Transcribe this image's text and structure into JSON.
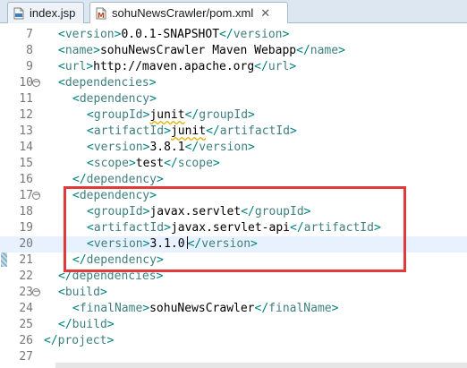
{
  "tabs": [
    {
      "label": "index.jsp",
      "active": false
    },
    {
      "label": "sohuNewsCrawler/pom.xml",
      "active": true
    }
  ],
  "lines": [
    {
      "num": "7",
      "indent": 1,
      "fold": false,
      "segs": [
        [
          "br",
          "<"
        ],
        [
          "tag",
          "version"
        ],
        [
          "br",
          ">"
        ],
        [
          "txt",
          "0.0.1-SNAPSHOT"
        ],
        [
          "br",
          "</"
        ],
        [
          "tag",
          "version"
        ],
        [
          "br",
          ">"
        ]
      ]
    },
    {
      "num": "8",
      "indent": 1,
      "fold": false,
      "segs": [
        [
          "br",
          "<"
        ],
        [
          "tag",
          "name"
        ],
        [
          "br",
          ">"
        ],
        [
          "txt",
          "sohuNewsCrawler Maven Webapp"
        ],
        [
          "br",
          "</"
        ],
        [
          "tag",
          "name"
        ],
        [
          "br",
          ">"
        ]
      ]
    },
    {
      "num": "9",
      "indent": 1,
      "fold": false,
      "segs": [
        [
          "br",
          "<"
        ],
        [
          "tag",
          "url"
        ],
        [
          "br",
          ">"
        ],
        [
          "txt",
          "http://maven.apache.org"
        ],
        [
          "br",
          "</"
        ],
        [
          "tag",
          "url"
        ],
        [
          "br",
          ">"
        ]
      ]
    },
    {
      "num": "10",
      "indent": 1,
      "fold": true,
      "segs": [
        [
          "br",
          "<"
        ],
        [
          "tag",
          "dependencies"
        ],
        [
          "br",
          ">"
        ]
      ]
    },
    {
      "num": "11",
      "indent": 2,
      "fold": false,
      "segs": [
        [
          "br",
          "<"
        ],
        [
          "tag",
          "dependency"
        ],
        [
          "br",
          ">"
        ]
      ]
    },
    {
      "num": "12",
      "indent": 3,
      "fold": false,
      "segs": [
        [
          "br",
          "<"
        ],
        [
          "tag",
          "groupId"
        ],
        [
          "br",
          ">"
        ],
        [
          "spell",
          "junit"
        ],
        [
          "br",
          "</"
        ],
        [
          "tag",
          "groupId"
        ],
        [
          "br",
          ">"
        ]
      ]
    },
    {
      "num": "13",
      "indent": 3,
      "fold": false,
      "segs": [
        [
          "br",
          "<"
        ],
        [
          "tag",
          "artifactId"
        ],
        [
          "br",
          ">"
        ],
        [
          "spell",
          "junit"
        ],
        [
          "br",
          "</"
        ],
        [
          "tag",
          "artifactId"
        ],
        [
          "br",
          ">"
        ]
      ]
    },
    {
      "num": "14",
      "indent": 3,
      "fold": false,
      "segs": [
        [
          "br",
          "<"
        ],
        [
          "tag",
          "version"
        ],
        [
          "br",
          ">"
        ],
        [
          "txt",
          "3.8.1"
        ],
        [
          "br",
          "</"
        ],
        [
          "tag",
          "version"
        ],
        [
          "br",
          ">"
        ]
      ]
    },
    {
      "num": "15",
      "indent": 3,
      "fold": false,
      "segs": [
        [
          "br",
          "<"
        ],
        [
          "tag",
          "scope"
        ],
        [
          "br",
          ">"
        ],
        [
          "txt",
          "test"
        ],
        [
          "br",
          "</"
        ],
        [
          "tag",
          "scope"
        ],
        [
          "br",
          ">"
        ]
      ]
    },
    {
      "num": "16",
      "indent": 2,
      "fold": false,
      "segs": [
        [
          "br",
          "</"
        ],
        [
          "tag",
          "dependency"
        ],
        [
          "br",
          ">"
        ]
      ]
    },
    {
      "num": "17",
      "indent": 2,
      "fold": true,
      "segs": [
        [
          "br",
          "<"
        ],
        [
          "tag",
          "dependency"
        ],
        [
          "br",
          ">"
        ]
      ]
    },
    {
      "num": "18",
      "indent": 3,
      "fold": false,
      "segs": [
        [
          "br",
          "<"
        ],
        [
          "tag",
          "groupId"
        ],
        [
          "br",
          ">"
        ],
        [
          "txt",
          "javax.servlet"
        ],
        [
          "br",
          "</"
        ],
        [
          "tag",
          "groupId"
        ],
        [
          "br",
          ">"
        ]
      ]
    },
    {
      "num": "19",
      "indent": 3,
      "fold": false,
      "segs": [
        [
          "br",
          "<"
        ],
        [
          "tag",
          "artifactId"
        ],
        [
          "br",
          ">"
        ],
        [
          "txt",
          "javax.servlet-api"
        ],
        [
          "br",
          "</"
        ],
        [
          "tag",
          "artifactId"
        ],
        [
          "br",
          ">"
        ]
      ]
    },
    {
      "num": "20",
      "indent": 3,
      "fold": false,
      "current": true,
      "segs": [
        [
          "br",
          "<"
        ],
        [
          "tag",
          "version"
        ],
        [
          "br",
          ">"
        ],
        [
          "txt",
          "3.1.0"
        ],
        [
          "br",
          "</"
        ],
        [
          "tag",
          "version"
        ],
        [
          "br",
          ">"
        ]
      ]
    },
    {
      "num": "21",
      "indent": 2,
      "fold": false,
      "segs": [
        [
          "br",
          "</"
        ],
        [
          "tag",
          "dependency"
        ],
        [
          "br",
          ">"
        ]
      ]
    },
    {
      "num": "22",
      "indent": 1,
      "fold": false,
      "segs": [
        [
          "br",
          "</"
        ],
        [
          "tag",
          "dependencies"
        ],
        [
          "br",
          ">"
        ]
      ]
    },
    {
      "num": "23",
      "indent": 1,
      "fold": true,
      "segs": [
        [
          "br",
          "<"
        ],
        [
          "tag",
          "build"
        ],
        [
          "br",
          ">"
        ]
      ]
    },
    {
      "num": "24",
      "indent": 2,
      "fold": false,
      "segs": [
        [
          "br",
          "<"
        ],
        [
          "tag",
          "finalName"
        ],
        [
          "br",
          ">"
        ],
        [
          "txt",
          "sohuNewsCrawler"
        ],
        [
          "br",
          "</"
        ],
        [
          "tag",
          "finalName"
        ],
        [
          "br",
          ">"
        ]
      ]
    },
    {
      "num": "25",
      "indent": 1,
      "fold": false,
      "segs": [
        [
          "br",
          "</"
        ],
        [
          "tag",
          "build"
        ],
        [
          "br",
          ">"
        ]
      ]
    },
    {
      "num": "26",
      "indent": 0,
      "fold": false,
      "segs": [
        [
          "br",
          "</"
        ],
        [
          "tag",
          "project"
        ],
        [
          "br",
          ">"
        ]
      ]
    },
    {
      "num": "27",
      "indent": 0,
      "fold": false,
      "segs": []
    }
  ],
  "colors": {
    "tag": "#3f7f7f",
    "bracket": "#008080",
    "text": "#000000",
    "highlight_box": "#e03a3a"
  },
  "icons": {
    "jsp_tab": "jsp-file-icon",
    "pom_tab": "maven-file-icon",
    "close": "close-icon"
  }
}
